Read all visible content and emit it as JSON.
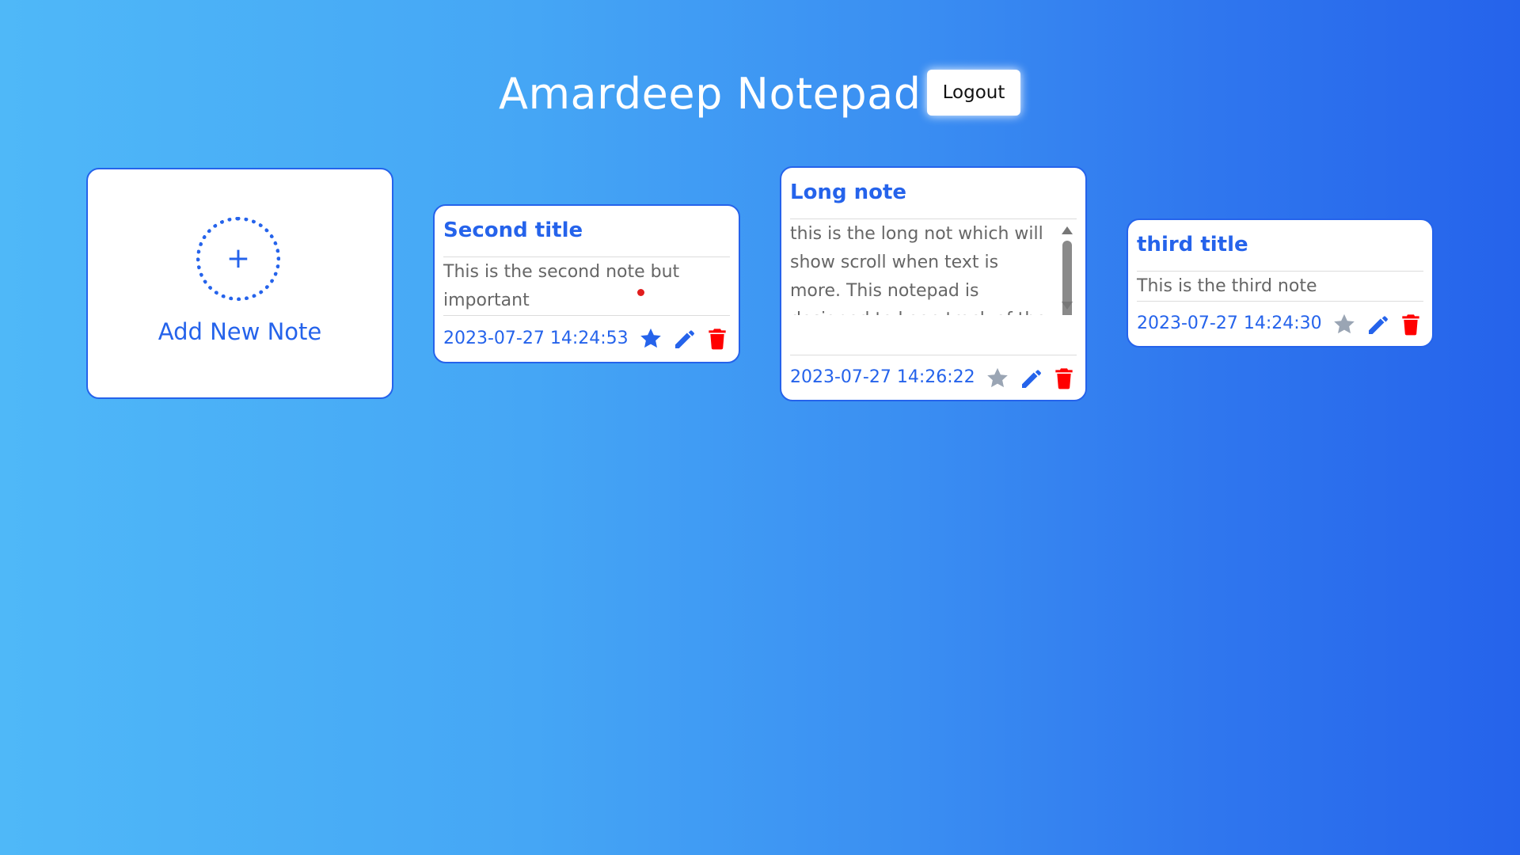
{
  "header": {
    "title": "Amardeep Notepad",
    "logout_label": "Logout"
  },
  "add_card": {
    "plus": "+",
    "label": "Add New Note"
  },
  "notes": [
    {
      "title": "Second title",
      "body": "This is the second note but important",
      "date": "2023-07-27 14:24:53",
      "important": true
    },
    {
      "title": "Long note",
      "body": "this is the long not which will show scroll when text is more. This notepad is designed to keep track of the notes and to remainder what next to do",
      "date": "2023-07-27 14:26:22",
      "important": false
    },
    {
      "title": "third title",
      "body": "This is the third note",
      "date": "2023-07-27 14:24:30",
      "important": false
    }
  ],
  "icons": {
    "star": "star-icon",
    "edit": "pencil-icon",
    "delete": "trash-icon"
  },
  "colors": {
    "accent": "#2563eb",
    "star_active": "#2563eb",
    "star_inactive": "#9aa5b4",
    "delete": "#ff0000",
    "body_text": "#666666"
  }
}
